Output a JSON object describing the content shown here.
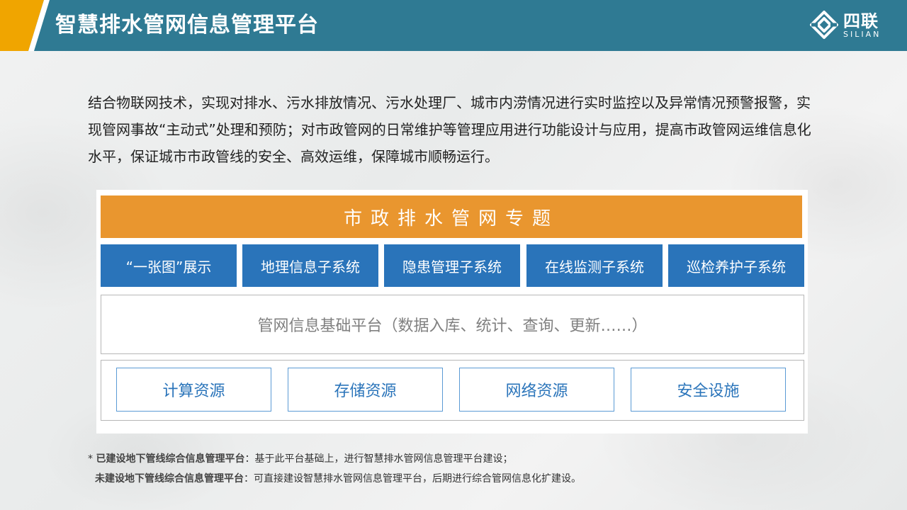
{
  "header": {
    "title": "智慧排水管网信息管理平台",
    "logo_cn": "四联",
    "logo_en": "SILIAN"
  },
  "intro": "结合物联网技术，实现对排水、污水排放情况、污水处理厂、城市内涝情况进行实时监控以及异常情况预警报警，实现管网事故“主动式”处理和预防；对市政管网的日常维护等管理应用进行功能设计与应用，提高市政管网运维信息化水平，保证城市市政管线的安全、高效运维，保障城市顺畅运行。",
  "diagram": {
    "topic": "市政排水管网专题",
    "subsystems": [
      "“一张图”展示",
      "地理信息子系统",
      "隐患管理子系统",
      "在线监测子系统",
      "巡检养护子系统"
    ],
    "base_platform": "管网信息基础平台（数据入库、统计、查询、更新……）",
    "resources": [
      "计算资源",
      "存储资源",
      "网络资源",
      "安全设施"
    ]
  },
  "notes": [
    {
      "prefix": "* ",
      "bold": "已建设地下管线综合信息管理平台",
      "text": "：基于此平台基础上，进行智慧排水管网信息管理平台建设；"
    },
    {
      "prefix": "",
      "bold": "未建设地下管线综合信息管理平台",
      "text": "：可直接建设智慧排水管网信息管理平台，后期进行综合管网信息化扩建设。"
    }
  ],
  "colors": {
    "header": "#2f7a93",
    "accent": "#f0a500",
    "topic": "#e9962f",
    "subsystem": "#2a74ba",
    "resource_border": "#5b9bd5"
  }
}
